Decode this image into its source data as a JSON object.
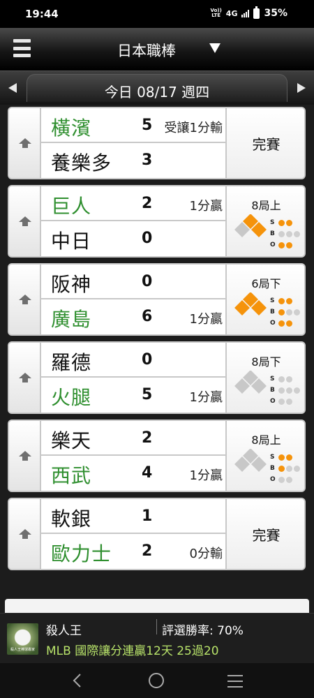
{
  "statusbar": {
    "time": "19:44",
    "volte_top": "Vo))",
    "volte_bottom": "LTE",
    "network": "4G",
    "battery": "35%"
  },
  "header": {
    "title": "日本職棒"
  },
  "datebar": {
    "date": "今日 08/17 週四"
  },
  "games": [
    {
      "home": {
        "name": "橫濱",
        "score": "5",
        "note": "受讓1分輸",
        "win": true
      },
      "away": {
        "name": "養樂多",
        "score": "3",
        "note": "",
        "win": false
      },
      "status": {
        "type": "final",
        "label": "完賽"
      }
    },
    {
      "home": {
        "name": "巨人",
        "score": "2",
        "note": "1分贏",
        "win": true
      },
      "away": {
        "name": "中日",
        "score": "0",
        "note": "",
        "win": false
      },
      "status": {
        "type": "live",
        "inning": "8局上",
        "bases": [
          true,
          true,
          false
        ],
        "strikes": 2,
        "balls": 0,
        "outs": 2
      }
    },
    {
      "home": {
        "name": "阪神",
        "score": "0",
        "note": "",
        "win": false
      },
      "away": {
        "name": "廣島",
        "score": "6",
        "note": "1分贏",
        "win": true
      },
      "status": {
        "type": "live",
        "inning": "6局下",
        "bases": [
          true,
          true,
          true
        ],
        "strikes": 2,
        "balls": 1,
        "outs": 2
      }
    },
    {
      "home": {
        "name": "羅德",
        "score": "0",
        "note": "",
        "win": false
      },
      "away": {
        "name": "火腿",
        "score": "5",
        "note": "1分贏",
        "win": true
      },
      "status": {
        "type": "live",
        "inning": "8局下",
        "bases": [
          false,
          false,
          false
        ],
        "strikes": 0,
        "balls": 0,
        "outs": 0
      }
    },
    {
      "home": {
        "name": "樂天",
        "score": "2",
        "note": "",
        "win": false
      },
      "away": {
        "name": "西武",
        "score": "4",
        "note": "1分贏",
        "win": true
      },
      "status": {
        "type": "live",
        "inning": "8局上",
        "bases": [
          false,
          false,
          false
        ],
        "strikes": 2,
        "balls": 1,
        "outs": 0
      }
    },
    {
      "home": {
        "name": "軟銀",
        "score": "1",
        "note": "",
        "win": false
      },
      "away": {
        "name": "歐力士",
        "score": "2",
        "note": "0分輸",
        "win": true
      },
      "status": {
        "type": "final",
        "label": "完賽"
      }
    }
  ],
  "count_labels": {
    "s": "S",
    "b": "B",
    "o": "O"
  },
  "ad": {
    "thumb_caption": "殺人王棒球專家",
    "name": "殺人王",
    "rate": "評選勝率: 70%",
    "promo": "MLB 國際讓分連贏12天 25過20"
  },
  "colors": {
    "win_team": "#2f8f2f",
    "count_on": "#f5930b",
    "base_on": "#f5930b",
    "base_off": "#c8c8c8",
    "promo": "#b8e36a"
  }
}
